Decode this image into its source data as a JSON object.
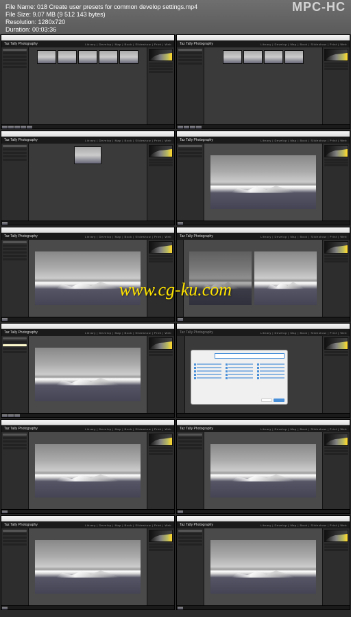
{
  "info": {
    "filename_label": "File Name:",
    "filename_value": "018 Create user presets for common develop settings.mp4",
    "filesize_label": "File Size:",
    "filesize_value": "9.07 MB (9 512 143 bytes)",
    "resolution_label": "Resolution:",
    "resolution_value": "1280x720",
    "duration_label": "Duration:",
    "duration_value": "00:03:36"
  },
  "app_name": "MPC-HC",
  "brand": "Taz Tally Photography",
  "modules": "Library | Develop | Map | Book | Slideshow | Print | Web",
  "dialog": {
    "preset_name_label": "Preset Name:",
    "preset_name_value": "Histogram (Good)",
    "folder_label": "Folder:",
    "folder_value": "User Presets",
    "create_btn": "Create",
    "cancel_btn": "Cancel"
  },
  "watermark": "www.cg-ku.com"
}
